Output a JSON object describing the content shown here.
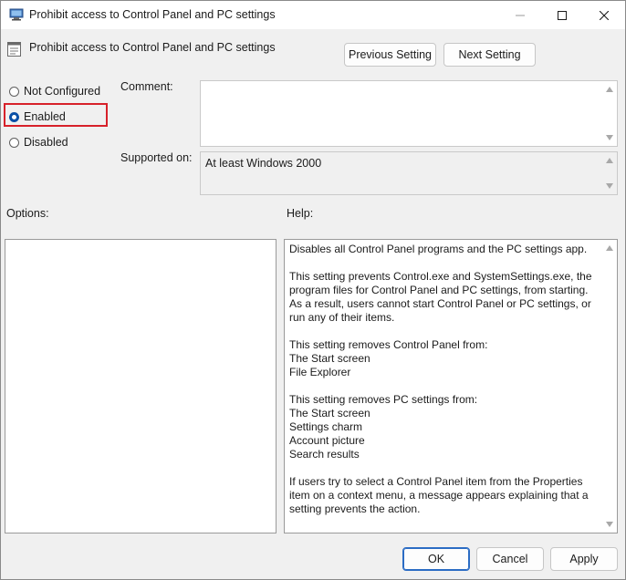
{
  "window": {
    "title": "Prohibit access to Control Panel and PC settings"
  },
  "header": {
    "setting_title": "Prohibit access to Control Panel and PC settings",
    "previous_label": "Previous Setting",
    "next_label": "Next Setting"
  },
  "state": {
    "options": [
      {
        "label": "Not Configured",
        "checked": false
      },
      {
        "label": "Enabled",
        "checked": true
      },
      {
        "label": "Disabled",
        "checked": false
      }
    ]
  },
  "comment": {
    "label": "Comment:",
    "value": ""
  },
  "supported": {
    "label": "Supported on:",
    "value": "At least Windows 2000"
  },
  "options_panel": {
    "label": "Options:"
  },
  "help_panel": {
    "label": "Help:",
    "text": "Disables all Control Panel programs and the PC settings app.\n\nThis setting prevents Control.exe and SystemSettings.exe, the program files for Control Panel and PC settings, from starting. As a result, users cannot start Control Panel or PC settings, or run any of their items.\n\nThis setting removes Control Panel from:\nThe Start screen\nFile Explorer\n\nThis setting removes PC settings from:\nThe Start screen\nSettings charm\nAccount picture\nSearch results\n\nIf users try to select a Control Panel item from the Properties item on a context menu, a message appears explaining that a setting prevents the action."
  },
  "footer": {
    "ok_label": "OK",
    "cancel_label": "Cancel",
    "apply_label": "Apply"
  },
  "colors": {
    "highlight": "#d7212a",
    "radio_accent": "#0a4fa6",
    "primary_border": "#2b6cc4"
  },
  "icons": {
    "app": "policy-app-icon",
    "setting": "policy-setting-icon"
  }
}
